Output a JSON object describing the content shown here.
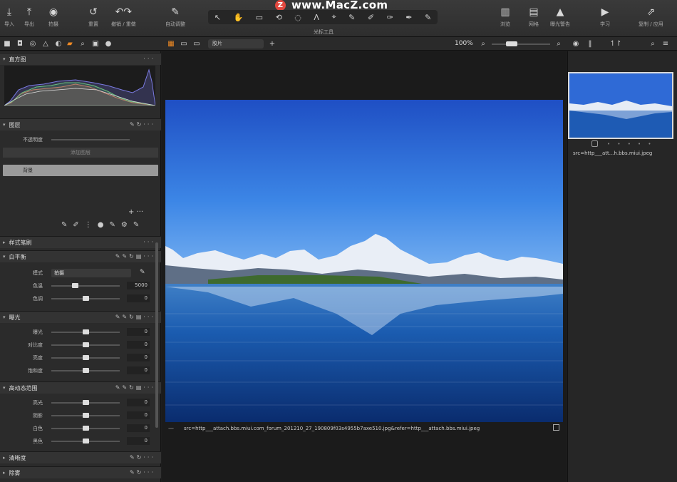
{
  "watermark": {
    "text": "www.MacZ.com",
    "logo": "Z"
  },
  "toolbar": {
    "left": [
      {
        "icon": "import-icon",
        "glyph": "⤓",
        "label": "导入"
      },
      {
        "icon": "export-icon",
        "glyph": "⤒",
        "label": "导出"
      },
      {
        "icon": "camera-icon",
        "glyph": "◉",
        "label": "拍摄"
      },
      {
        "icon": "reset-icon",
        "glyph": "↺",
        "label": "重置"
      },
      {
        "icon": "undo-redo-icon",
        "glyph": "↶↷",
        "label": "撤销 / 重做"
      },
      {
        "icon": "auto-adjust-icon",
        "glyph": "✎",
        "label": "自动调整"
      }
    ],
    "cursor_tools_label": "光标工具",
    "cursor_tools": [
      "↖",
      "✋",
      "▭",
      "⟲",
      "◌",
      "Λ",
      "⌖",
      "✎",
      "✐",
      "✑",
      "✒",
      "✎"
    ],
    "right": [
      {
        "icon": "viewer-icon",
        "glyph": "▥",
        "label": "浏览"
      },
      {
        "icon": "browser-icon",
        "glyph": "▤",
        "label": "网格"
      },
      {
        "icon": "exposure-warning-icon",
        "glyph": "▲",
        "label": "曝光警告"
      },
      {
        "icon": "learn-icon",
        "glyph": "▶",
        "label": "学习"
      },
      {
        "icon": "copy-apply-icon",
        "glyph": "⇗",
        "label": "复制 / 应用"
      }
    ]
  },
  "subbar": {
    "view_select": "胶片",
    "zoom": "100%"
  },
  "left_panel": {
    "histogram_title": "直方图",
    "layers_title": "图层",
    "opacity_label": "不透明度",
    "add_layer_label": "添加图层",
    "background_layer": "背景",
    "styles_title": "样式笔刷",
    "white_balance": {
      "title": "白平衡",
      "mode_label": "模式",
      "mode_value": "拍摄",
      "rows": [
        {
          "label": "色温",
          "value": "5000",
          "pos": 0.34
        },
        {
          "label": "色调",
          "value": "0",
          "pos": 0.5
        }
      ]
    },
    "exposure": {
      "title": "曝光",
      "rows": [
        {
          "label": "曝光",
          "value": "0",
          "pos": 0.5
        },
        {
          "label": "对比度",
          "value": "0",
          "pos": 0.5
        },
        {
          "label": "亮度",
          "value": "0",
          "pos": 0.5
        },
        {
          "label": "饱和度",
          "value": "0",
          "pos": 0.5
        }
      ]
    },
    "hdr": {
      "title": "高动态范围",
      "rows": [
        {
          "label": "高光",
          "value": "0",
          "pos": 0.5
        },
        {
          "label": "阴影",
          "value": "0",
          "pos": 0.5
        },
        {
          "label": "白色",
          "value": "0",
          "pos": 0.5
        },
        {
          "label": "黑色",
          "value": "0",
          "pos": 0.5
        }
      ]
    },
    "clarity_title": "清晰度",
    "dehaze_title": "除雾"
  },
  "viewer": {
    "caption": "src=http___attach.bbs.miui.com_forum_201210_27_190809f03s4955b7axe510.jpg&refer=http___attach.bbs.miui.jpeg"
  },
  "right_panel": {
    "thumb_name": "src=http___att...h.bbs.miui.jpeg",
    "thumb_dots": "• • • • •"
  },
  "colors": {
    "accent": "#f08a24",
    "panel": "#2b2b2b",
    "viewer": "#1b1b1b"
  }
}
